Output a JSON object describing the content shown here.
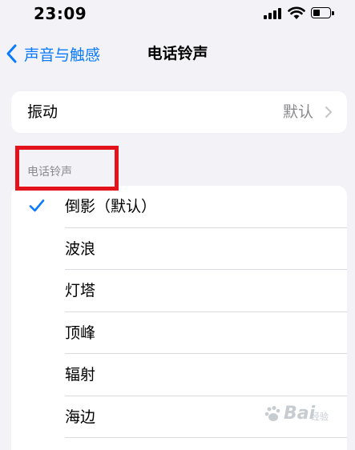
{
  "status_bar": {
    "time": "23:09",
    "icons": [
      "signal-icon",
      "wifi-icon",
      "battery-icon"
    ]
  },
  "nav": {
    "back_label": "声音与触感",
    "title": "电话铃声"
  },
  "vibration": {
    "label": "振动",
    "value": "默认"
  },
  "ringtone_section": {
    "header": "电话铃声",
    "items": [
      {
        "label": "倒影（默认）",
        "selected": true
      },
      {
        "label": "波浪",
        "selected": false
      },
      {
        "label": "灯塔",
        "selected": false
      },
      {
        "label": "顶峰",
        "selected": false
      },
      {
        "label": "辐射",
        "selected": false
      },
      {
        "label": "海边",
        "selected": false
      }
    ]
  },
  "watermark": {
    "text": "Bai",
    "sub": "经验"
  },
  "colors": {
    "accent": "#0a7aff",
    "background": "#f2f2f7",
    "annotation": "#e3131b",
    "secondary_text": "#8a8a8e"
  }
}
